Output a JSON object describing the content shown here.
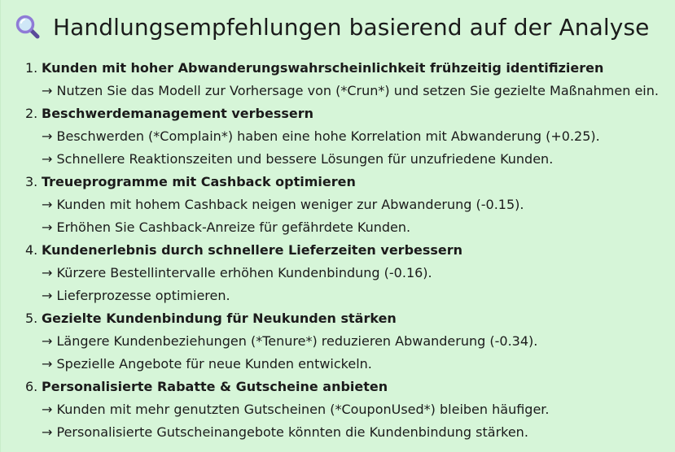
{
  "header": {
    "icon": "magnifying-glass-icon",
    "title": "Handlungsempfehlungen basierend auf der Analyse"
  },
  "recommendations": [
    {
      "number": "1.",
      "title": "Kunden mit hoher Abwanderungswahrscheinlichkeit frühzeitig identifizieren",
      "details": [
        "→ Nutzen Sie das Modell zur Vorhersage von (*Crun*) und setzen Sie gezielte Maßnahmen ein."
      ]
    },
    {
      "number": "2.",
      "title": "Beschwerdemanagement verbessern",
      "details": [
        "→ Beschwerden (*Complain*) haben eine hohe Korrelation mit Abwanderung (+0.25).",
        "→ Schnellere Reaktionszeiten und bessere Lösungen für unzufriedene Kunden."
      ]
    },
    {
      "number": "3.",
      "title": "Treueprogramme mit Cashback optimieren",
      "details": [
        "→ Kunden mit hohem Cashback neigen weniger zur Abwanderung (-0.15).",
        "→ Erhöhen Sie Cashback-Anreize für gefährdete Kunden."
      ]
    },
    {
      "number": "4.",
      "title": "Kundenerlebnis durch schnellere Lieferzeiten verbessern",
      "details": [
        "→ Kürzere Bestellintervalle erhöhen Kundenbindung (-0.16).",
        "→ Lieferprozesse optimieren."
      ]
    },
    {
      "number": "5.",
      "title": "Gezielte Kundenbindung für Neukunden stärken",
      "details": [
        "→ Längere Kundenbeziehungen (*Tenure*) reduzieren Abwanderung (-0.34).",
        "→ Spezielle Angebote für neue Kunden entwickeln."
      ]
    },
    {
      "number": "6.",
      "title": "Personalisierte Rabatte & Gutscheine anbieten",
      "details": [
        "→ Kunden mit mehr genutzten Gutscheinen (*CouponUsed*) bleiben häufiger.",
        "→ Personalisierte Gutscheinangebote könnten die Kundenbindung stärken."
      ]
    }
  ],
  "colors": {
    "panel_background": "#d6f5d8",
    "text": "#1b1b1b",
    "icon_lens": "#8f7bd6"
  }
}
